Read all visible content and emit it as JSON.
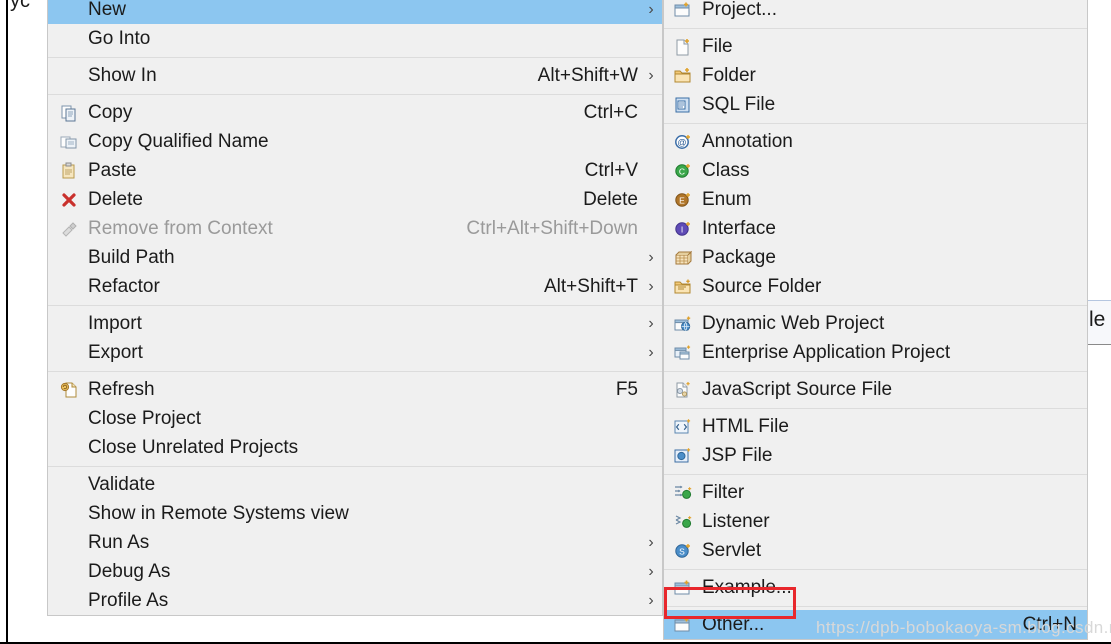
{
  "background": {
    "tree_glyph": "yc",
    "right_tab_label": "le"
  },
  "watermark": {
    "text": "https://dpb-bobokaoya-sm.blog.csdn.net"
  },
  "colors": {
    "menu_background": "#f0f0f0",
    "selection": "#8cc6f0",
    "highlight_box": "#e8272c",
    "separator": "#dcdcdc",
    "text": "#1b1b1b",
    "disabled_text": "#9a9a9a"
  },
  "context_menu": {
    "name": "project-context-menu",
    "items": [
      {
        "id": "new",
        "label": "New",
        "accel": "",
        "submenu": true,
        "selected": true,
        "disabled": false,
        "icon": ""
      },
      {
        "id": "go-into",
        "label": "Go Into",
        "accel": "",
        "submenu": false,
        "selected": false,
        "disabled": false,
        "icon": ""
      },
      {
        "id": "sep-1",
        "separator": true
      },
      {
        "id": "show-in",
        "label": "Show In",
        "accel": "Alt+Shift+W",
        "submenu": true,
        "selected": false,
        "disabled": false,
        "icon": ""
      },
      {
        "id": "sep-2",
        "separator": true
      },
      {
        "id": "copy",
        "label": "Copy",
        "accel": "Ctrl+C",
        "submenu": false,
        "selected": false,
        "disabled": false,
        "icon": "copy-icon"
      },
      {
        "id": "copy-qualified-name",
        "label": "Copy Qualified Name",
        "accel": "",
        "submenu": false,
        "selected": false,
        "disabled": false,
        "icon": "copy-qualified-icon"
      },
      {
        "id": "paste",
        "label": "Paste",
        "accel": "Ctrl+V",
        "submenu": false,
        "selected": false,
        "disabled": false,
        "icon": "paste-icon"
      },
      {
        "id": "delete",
        "label": "Delete",
        "accel": "Delete",
        "submenu": false,
        "selected": false,
        "disabled": false,
        "icon": "delete-x-icon"
      },
      {
        "id": "remove-from-context",
        "label": "Remove from Context",
        "accel": "Ctrl+Alt+Shift+Down",
        "submenu": false,
        "selected": false,
        "disabled": true,
        "icon": "remove-context-icon"
      },
      {
        "id": "build-path",
        "label": "Build Path",
        "accel": "",
        "submenu": true,
        "selected": false,
        "disabled": false,
        "icon": ""
      },
      {
        "id": "refactor",
        "label": "Refactor",
        "accel": "Alt+Shift+T",
        "submenu": true,
        "selected": false,
        "disabled": false,
        "icon": ""
      },
      {
        "id": "sep-3",
        "separator": true
      },
      {
        "id": "import",
        "label": "Import",
        "accel": "",
        "submenu": true,
        "selected": false,
        "disabled": false,
        "icon": ""
      },
      {
        "id": "export",
        "label": "Export",
        "accel": "",
        "submenu": true,
        "selected": false,
        "disabled": false,
        "icon": ""
      },
      {
        "id": "sep-4",
        "separator": true
      },
      {
        "id": "refresh",
        "label": "Refresh",
        "accel": "F5",
        "submenu": false,
        "selected": false,
        "disabled": false,
        "icon": "refresh-icon"
      },
      {
        "id": "close-project",
        "label": "Close Project",
        "accel": "",
        "submenu": false,
        "selected": false,
        "disabled": false,
        "icon": ""
      },
      {
        "id": "close-unrelated-projects",
        "label": "Close Unrelated Projects",
        "accel": "",
        "submenu": false,
        "selected": false,
        "disabled": false,
        "icon": ""
      },
      {
        "id": "sep-5",
        "separator": true
      },
      {
        "id": "validate",
        "label": "Validate",
        "accel": "",
        "submenu": false,
        "selected": false,
        "disabled": false,
        "icon": ""
      },
      {
        "id": "show-in-remote-systems",
        "label": "Show in Remote Systems view",
        "accel": "",
        "submenu": false,
        "selected": false,
        "disabled": false,
        "icon": ""
      },
      {
        "id": "run-as",
        "label": "Run As",
        "accel": "",
        "submenu": true,
        "selected": false,
        "disabled": false,
        "icon": ""
      },
      {
        "id": "debug-as",
        "label": "Debug As",
        "accel": "",
        "submenu": true,
        "selected": false,
        "disabled": false,
        "icon": ""
      },
      {
        "id": "profile-as",
        "label": "Profile As",
        "accel": "",
        "submenu": true,
        "selected": false,
        "disabled": false,
        "icon": ""
      }
    ]
  },
  "new_submenu": {
    "name": "new-submenu",
    "items": [
      {
        "id": "project",
        "label": "Project...",
        "accel": "",
        "selected": false,
        "icon": "new-project-icon"
      },
      {
        "id": "sep-1",
        "separator": true
      },
      {
        "id": "file",
        "label": "File",
        "accel": "",
        "selected": false,
        "icon": "new-file-icon"
      },
      {
        "id": "folder",
        "label": "Folder",
        "accel": "",
        "selected": false,
        "icon": "new-folder-icon"
      },
      {
        "id": "sql-file",
        "label": "SQL File",
        "accel": "",
        "selected": false,
        "icon": "sql-file-icon"
      },
      {
        "id": "sep-2",
        "separator": true
      },
      {
        "id": "annotation",
        "label": "Annotation",
        "accel": "",
        "selected": false,
        "icon": "annotation-icon"
      },
      {
        "id": "class",
        "label": "Class",
        "accel": "",
        "selected": false,
        "icon": "class-icon"
      },
      {
        "id": "enum",
        "label": "Enum",
        "accel": "",
        "selected": false,
        "icon": "enum-icon"
      },
      {
        "id": "interface",
        "label": "Interface",
        "accel": "",
        "selected": false,
        "icon": "interface-icon"
      },
      {
        "id": "package",
        "label": "Package",
        "accel": "",
        "selected": false,
        "icon": "package-icon"
      },
      {
        "id": "source-folder",
        "label": "Source Folder",
        "accel": "",
        "selected": false,
        "icon": "source-folder-icon"
      },
      {
        "id": "sep-3",
        "separator": true
      },
      {
        "id": "dynamic-web-project",
        "label": "Dynamic Web Project",
        "accel": "",
        "selected": false,
        "icon": "dynamic-web-project-icon"
      },
      {
        "id": "enterprise-application-project",
        "label": "Enterprise Application Project",
        "accel": "",
        "selected": false,
        "icon": "enterprise-app-project-icon"
      },
      {
        "id": "sep-4",
        "separator": true
      },
      {
        "id": "javascript-source-file",
        "label": "JavaScript Source File",
        "accel": "",
        "selected": false,
        "icon": "javascript-source-file-icon"
      },
      {
        "id": "sep-5",
        "separator": true
      },
      {
        "id": "html-file",
        "label": "HTML File",
        "accel": "",
        "selected": false,
        "icon": "html-file-icon"
      },
      {
        "id": "jsp-file",
        "label": "JSP File",
        "accel": "",
        "selected": false,
        "icon": "jsp-file-icon"
      },
      {
        "id": "sep-6",
        "separator": true
      },
      {
        "id": "filter",
        "label": "Filter",
        "accel": "",
        "selected": false,
        "icon": "filter-icon"
      },
      {
        "id": "listener",
        "label": "Listener",
        "accel": "",
        "selected": false,
        "icon": "listener-icon"
      },
      {
        "id": "servlet",
        "label": "Servlet",
        "accel": "",
        "selected": false,
        "icon": "servlet-icon"
      },
      {
        "id": "sep-7",
        "separator": true
      },
      {
        "id": "example",
        "label": "Example...",
        "accel": "",
        "selected": false,
        "icon": "example-icon"
      },
      {
        "id": "sep-8",
        "separator": true
      },
      {
        "id": "other",
        "label": "Other...",
        "accel": "Ctrl+N",
        "selected": true,
        "icon": "other-icon",
        "highlighted": true
      }
    ]
  }
}
